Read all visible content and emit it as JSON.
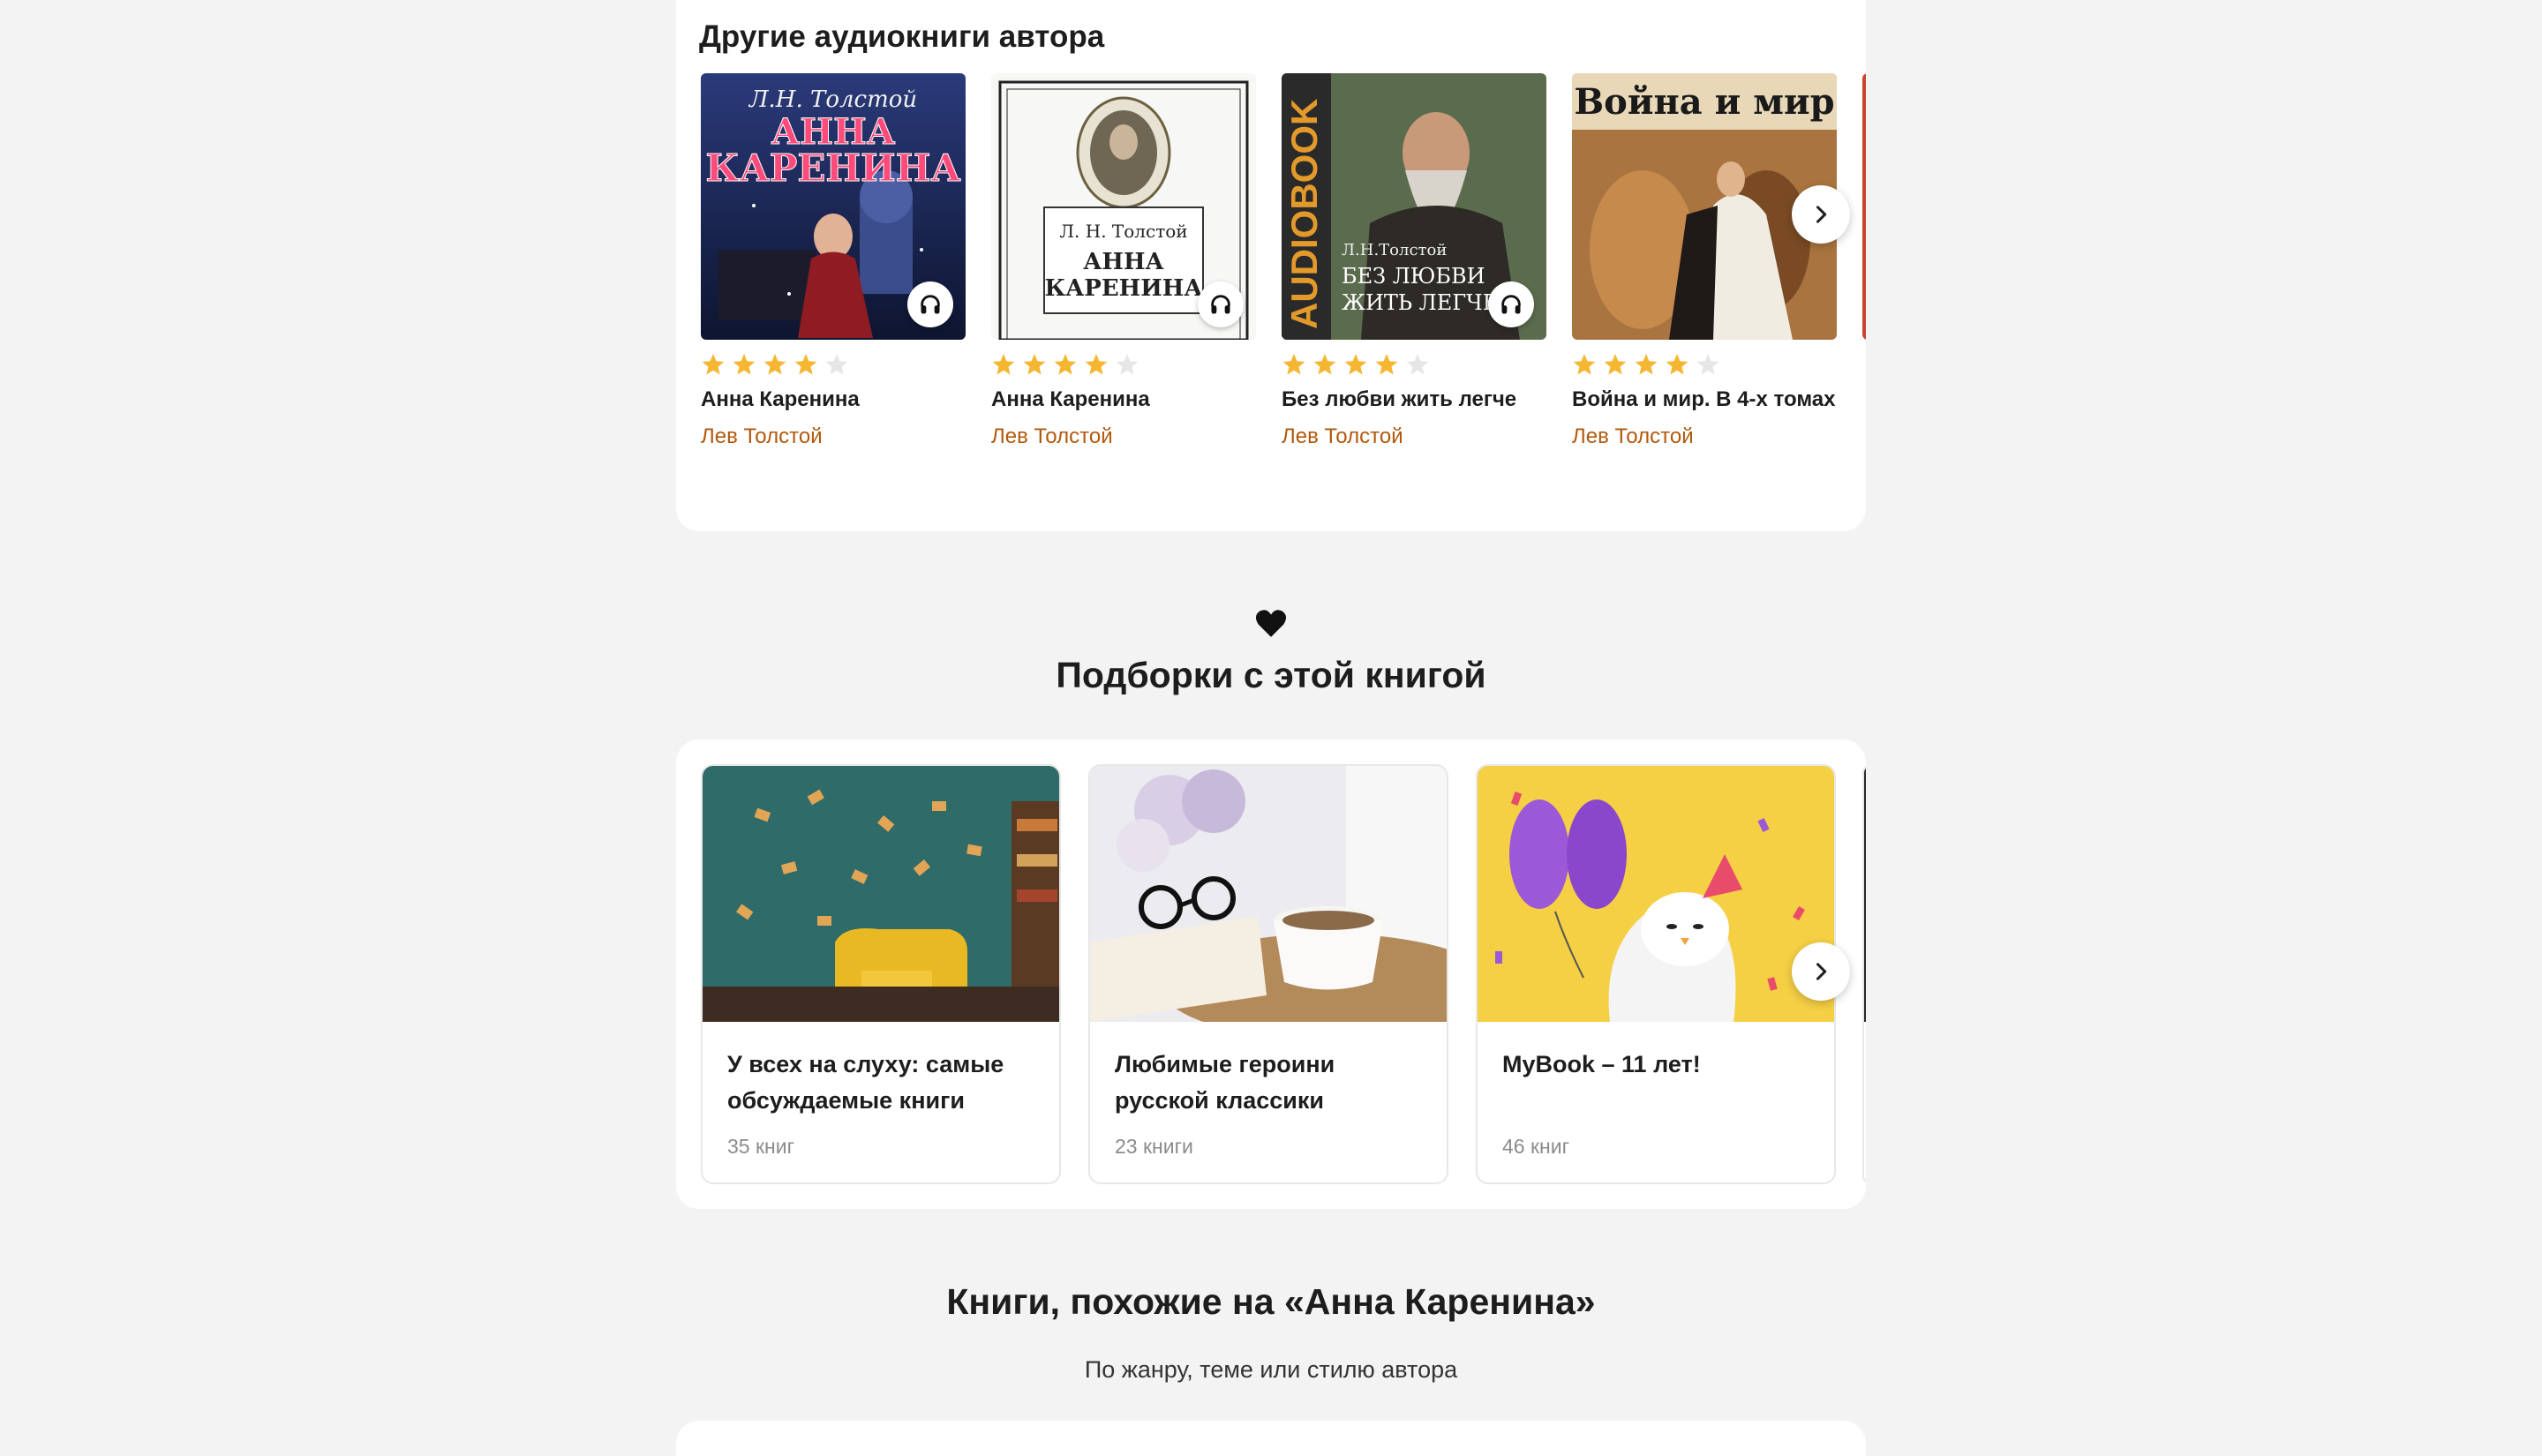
{
  "author_books": {
    "heading": "Другие аудиокниги автора",
    "items": [
      {
        "title": "Анна Каренина",
        "author": "Лев Толстой",
        "rating": 4,
        "cover_texts": [
          "Л.Н. Толстой",
          "АННА",
          "КАРЕНИНА"
        ]
      },
      {
        "title": "Анна Каренина",
        "author": "Лев Толстой",
        "rating": 4,
        "cover_texts": [
          "Л. Н. Толстой",
          "АННА",
          "КАРЕНИНА"
        ]
      },
      {
        "title": "Без любви жить легче",
        "author": "Лев Толстой",
        "rating": 4,
        "cover_texts": [
          "AUDIOBOOK",
          "Л.Н.Толстой",
          "БЕЗ ЛЮБВИ",
          "ЖИТЬ ЛЕГЧЕ"
        ]
      },
      {
        "title": "Война и мир. В 4-х томах",
        "author": "Лев Толстой",
        "rating": 4,
        "cover_texts": [
          "Война и мир"
        ]
      }
    ]
  },
  "collections": {
    "heading": "Подборки с этой книгой",
    "items": [
      {
        "title": "У всех на слуху: самые обсуждаемые книги",
        "count": "35 книг"
      },
      {
        "title": "Любимые героини русской классики",
        "count": "23 книги"
      },
      {
        "title": "MyBook – 11 лет!",
        "count": "46 книг"
      }
    ]
  },
  "similar": {
    "heading": "Книги, похожие на «Анна Каренина»",
    "subtext": "По жанру, теме или стилю автора"
  },
  "colors": {
    "star": "#f5b731",
    "star_empty": "#e6e6e6",
    "author_link": "#b2590c",
    "background": "#f3f3f3"
  },
  "icons": [
    "headphones-icon",
    "chevron-right-icon",
    "heart-icon",
    "star-icon"
  ]
}
